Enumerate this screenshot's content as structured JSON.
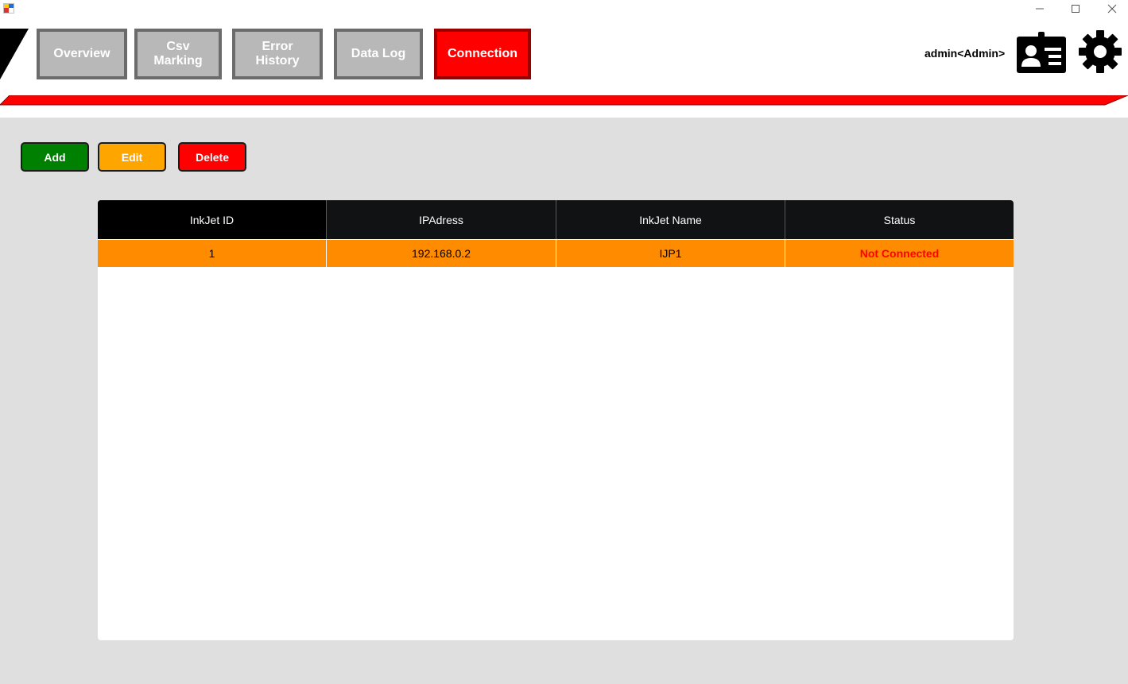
{
  "nav": {
    "tabs": [
      {
        "label": "Overview"
      },
      {
        "label": "Csv\nMarking"
      },
      {
        "label": "Error\nHistory"
      },
      {
        "label": "Data Log"
      },
      {
        "label": "Connection"
      }
    ],
    "active_tab": "Connection"
  },
  "user": {
    "label": "admin<Admin>"
  },
  "actions": {
    "add_label": "Add",
    "edit_label": "Edit",
    "delete_label": "Delete"
  },
  "table": {
    "columns": [
      "InkJet ID",
      "IPAdress",
      "InkJet Name",
      "Status"
    ],
    "rows": [
      {
        "id": "1",
        "ip": "192.168.0.2",
        "name": "IJP1",
        "status": "Not Connected"
      }
    ]
  },
  "colors": {
    "accent": "#ff0000",
    "add": "#008000",
    "edit": "#ffa500",
    "delete": "#ff0000",
    "row_selected": "#ff8c00",
    "status_not_connected": "#ff0000",
    "content_bg": "#dfdfdf"
  },
  "icons": {
    "window_controls": [
      "minimize-icon",
      "maximize-icon",
      "close-icon"
    ],
    "user": "id-card-icon",
    "settings": "gear-icon"
  }
}
